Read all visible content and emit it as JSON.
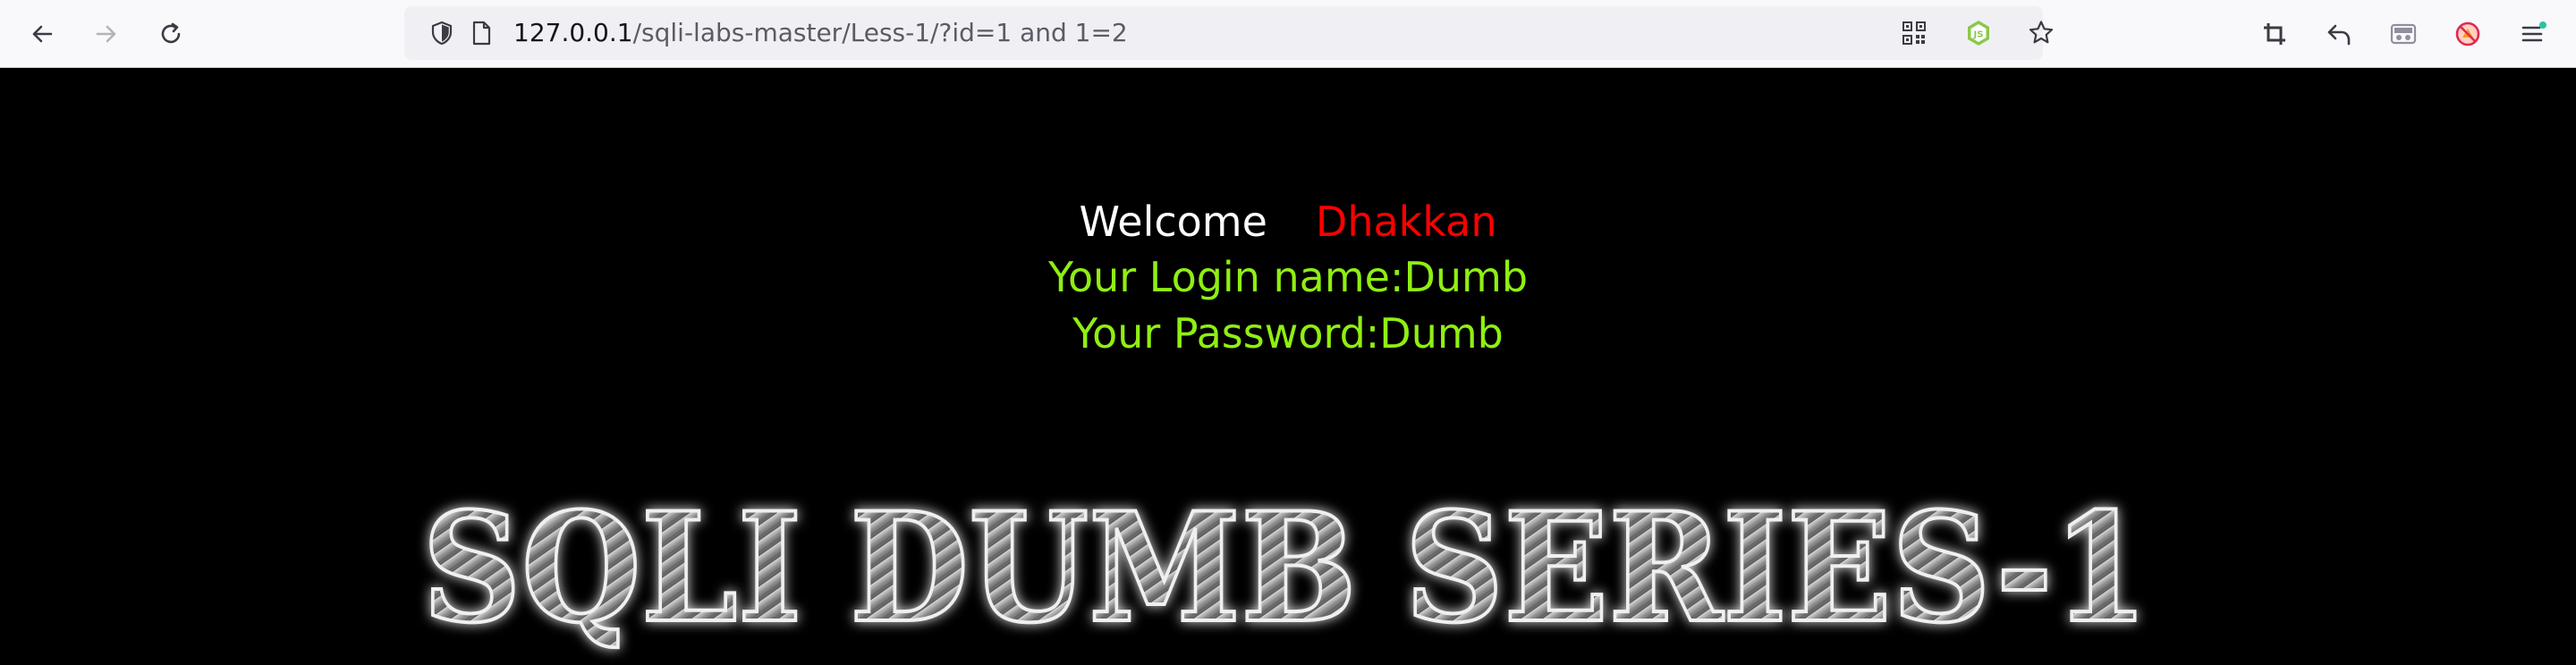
{
  "browser": {
    "url_host": "127.0.0.1",
    "url_path": "/sqli-labs-master/Less-1/?id=1 and 1=2",
    "icons": {
      "back": "arrow-left-icon",
      "forward": "arrow-right-icon",
      "reload": "reload-icon",
      "tracking": "shield-icon",
      "page": "page-icon",
      "qr": "qr-code-icon",
      "node": "nodejs-icon",
      "bookmark": "star-icon",
      "crop": "crop-icon",
      "undo": "undo-icon",
      "reader": "reader-view-icon",
      "blocker": "blocked-extension-icon",
      "menu": "hamburger-menu-icon"
    }
  },
  "page": {
    "welcome_label": "Welcome",
    "welcome_name": "Dhakkan",
    "login_line": "Your Login name:Dumb",
    "password_line": "Your Password:Dumb",
    "banner_text": "SQLI DUMB SERIES-1"
  },
  "colors": {
    "background": "#000000",
    "welcome": "#ffffff",
    "name": "#ff0000",
    "info": "#8fef12",
    "banner_fill": "#8a8a8a",
    "banner_glow": "#ffffff"
  }
}
